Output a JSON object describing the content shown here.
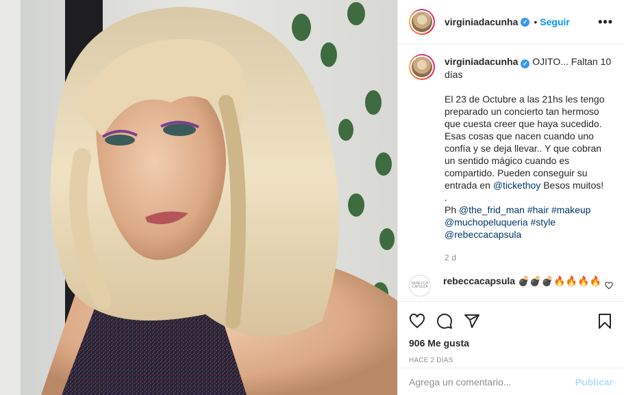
{
  "post": {
    "username": "virginiadacunha",
    "follow_label": "Seguir",
    "dot": "•",
    "more_label": "•••",
    "verified_mark": "✓"
  },
  "caption": {
    "username": "virginiadacunha",
    "title": "OJITO... Faltan 10 días",
    "body": "El 23 de Octubre a las 21hs les tengo preparado un concierto tan hermoso que cuesta creer que haya sucedido. Esas cosas que nacen cuando uno confía y se deja llevar.. Y que cobran un sentido mágico cuando es compartido. Pueden conseguir su entrada en",
    "mention_ticket": "@tickethoy",
    "body_end": "Besos muitos!",
    "period": ".",
    "credits_prefix": "Ph",
    "credit_1": "@the_frid_man",
    "credit_2": "#hair",
    "credit_3": "#makeup",
    "credit_4": "@muchopeluqueria",
    "credit_5": "#style",
    "credit_6": "@rebeccacapsula",
    "time": "2 d"
  },
  "comment": {
    "username": "rebeccacapsula",
    "text": "💣💣💣🔥🔥🔥🔥",
    "avatar_text": "REBECCA CAPSULA"
  },
  "actions": {
    "likes": "906 Me gusta",
    "posted": "HACE 2 DÍAS"
  },
  "add_comment": {
    "placeholder": "Agrega un comentario...",
    "publish": "Publicar"
  },
  "colors": {
    "accent": "#0095f6",
    "link": "#00376b",
    "muted": "#8e8e8e",
    "verified": "#3897f0"
  }
}
